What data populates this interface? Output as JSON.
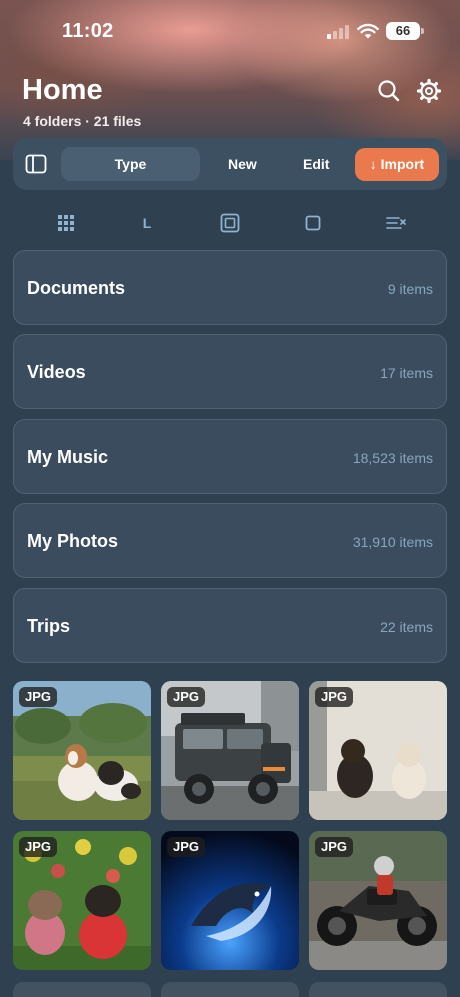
{
  "status_bar": {
    "time": "11:02",
    "battery": "66"
  },
  "header": {
    "title": "Home",
    "subtitle": "4 folders · 21 files"
  },
  "toolbar": {
    "type_label": "Type",
    "new_label": "New",
    "edit_label": "Edit",
    "import_label": "↓ Import"
  },
  "view_options": {
    "l_label": "L"
  },
  "folders": [
    {
      "name": "Documents",
      "count": "9 items"
    },
    {
      "name": "Videos",
      "count": "17 items"
    },
    {
      "name": "My Music",
      "count": "18,523 items"
    },
    {
      "name": "My Photos",
      "count": "31,910 items"
    },
    {
      "name": "Trips",
      "count": "22 items"
    }
  ],
  "files": [
    {
      "badge": "JPG"
    },
    {
      "badge": "JPG"
    },
    {
      "badge": "JPG"
    },
    {
      "badge": "JPG"
    },
    {
      "badge": "JPG"
    },
    {
      "badge": "JPG"
    }
  ],
  "colors": {
    "accent": "#ea7a4d",
    "background": "#2f4050",
    "card": "#3a4c5d"
  }
}
